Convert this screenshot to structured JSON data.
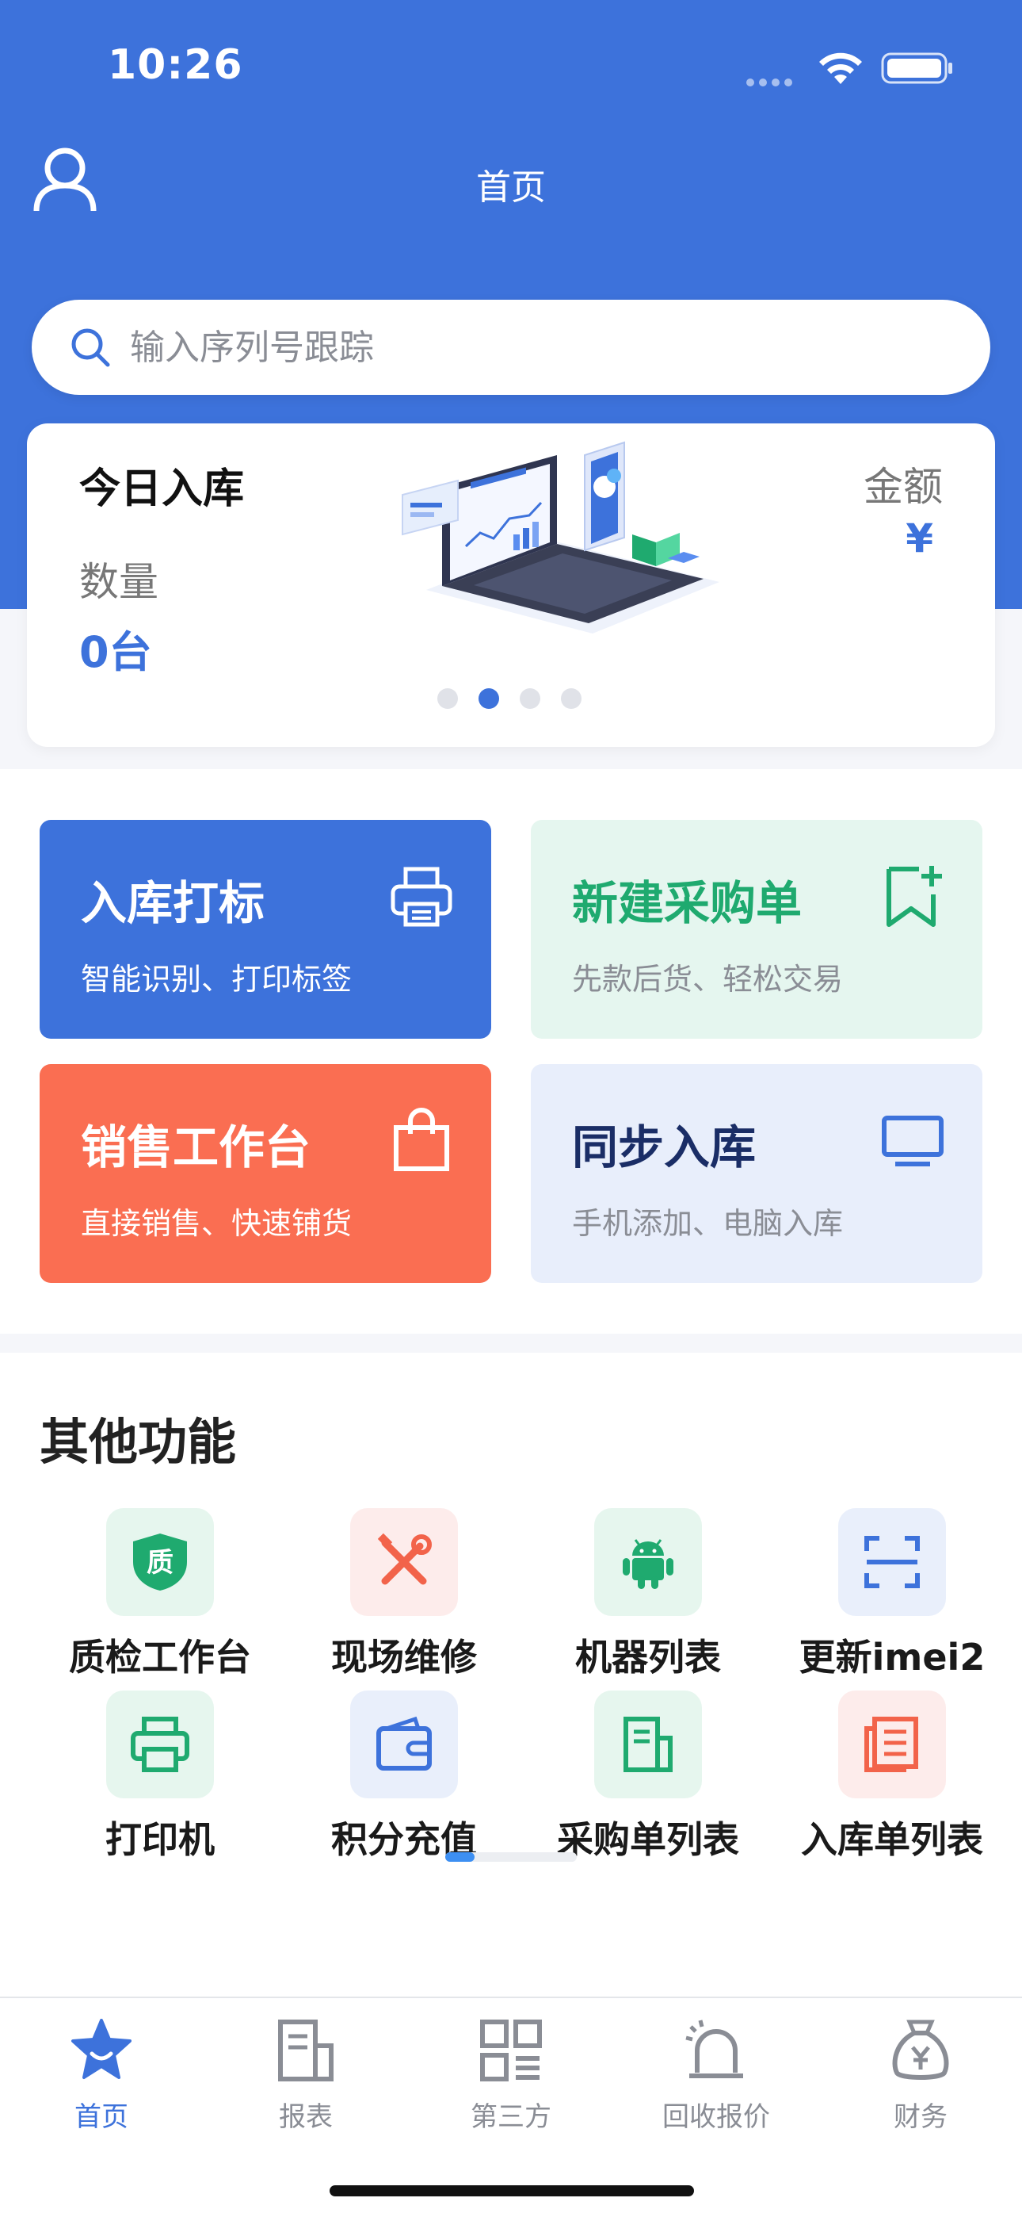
{
  "status_bar": {
    "time": "10:26"
  },
  "nav": {
    "title": "首页"
  },
  "search": {
    "placeholder": "输入序列号跟踪"
  },
  "stats": {
    "title": "今日入库",
    "quantity_label": "数量",
    "quantity_value": "0台",
    "amount_label": "金额",
    "amount_value": "¥",
    "carousel_page": 2,
    "carousel_total": 4
  },
  "quick_actions": [
    {
      "title": "入库打标",
      "subtitle": "智能识别、打印标签",
      "icon": "printer-icon"
    },
    {
      "title": "新建采购单",
      "subtitle": "先款后货、轻松交易",
      "icon": "bookmark-add-icon"
    },
    {
      "title": "销售工作台",
      "subtitle": "直接销售、快速铺货",
      "icon": "shopping-bag-icon"
    },
    {
      "title": "同步入库",
      "subtitle": "手机添加、电脑入库",
      "icon": "monitor-icon"
    }
  ],
  "other_functions": {
    "title": "其他功能",
    "items": [
      {
        "label": "质检工作台",
        "icon": "quality-shield-icon",
        "icon_text": "质"
      },
      {
        "label": "现场维修",
        "icon": "repair-tools-icon"
      },
      {
        "label": "机器列表",
        "icon": "android-icon"
      },
      {
        "label": "更新imei2",
        "icon": "scan-frame-icon"
      },
      {
        "label": "打印机",
        "icon": "printer-icon"
      },
      {
        "label": "积分充值",
        "icon": "wallet-icon"
      },
      {
        "label": "采购单列表",
        "icon": "document-icon"
      },
      {
        "label": "入库单列表",
        "icon": "list-document-icon"
      }
    ],
    "scroll_progress": 0.22
  },
  "tabbar": [
    {
      "label": "首页",
      "icon": "home-star-icon",
      "active": true
    },
    {
      "label": "报表",
      "icon": "report-icon",
      "active": false
    },
    {
      "label": "第三方",
      "icon": "grid-icon",
      "active": false
    },
    {
      "label": "回收报价",
      "icon": "alarm-bell-icon",
      "active": false
    },
    {
      "label": "财务",
      "icon": "money-bag-icon",
      "active": false
    }
  ],
  "colors": {
    "primary": "#3d72db",
    "green": "#1faa6f",
    "orange": "#fa6e52",
    "navy": "#1a2d66"
  }
}
